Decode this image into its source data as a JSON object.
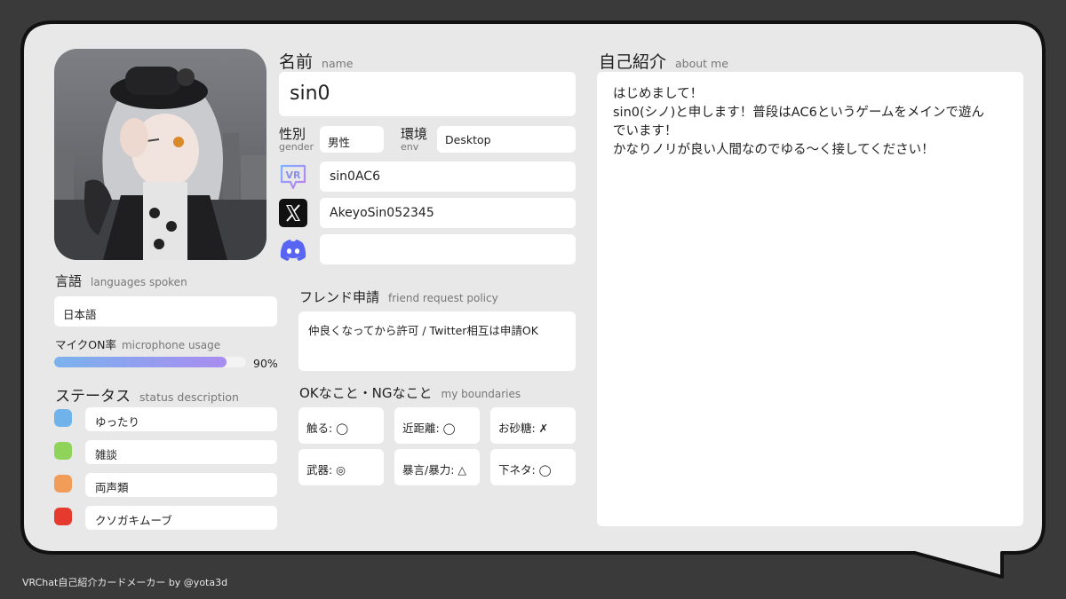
{
  "profile": {
    "avatar_alt": "avatar portrait",
    "name_title": "名前",
    "name_sub": "name",
    "name_value": "sin0",
    "gender_title": "性別",
    "gender_sub": "gender",
    "gender_value": "男性",
    "env_title": "環境",
    "env_sub": "env",
    "env_value": "Desktop",
    "vrchat_icon": "vrchat-icon",
    "vrchat_id": "sin0AC6",
    "x_icon": "x-logo-icon",
    "x_id": "AkeyoSin052345",
    "discord_icon": "discord-icon",
    "discord_id": ""
  },
  "languages": {
    "title": "言語",
    "sub": "languages spoken",
    "value": "日本語"
  },
  "mic": {
    "title": "マイクON率",
    "sub": "microphone usage",
    "percent_label": "90%",
    "level": 0.9
  },
  "status": {
    "title": "ステータス",
    "sub": "status description",
    "items": [
      {
        "label": "ゆったり",
        "color": "#6fb3ea"
      },
      {
        "label": "雑談",
        "color": "#8fd35b"
      },
      {
        "label": "両声類",
        "color": "#f19c59"
      },
      {
        "label": "クソガキムーブ",
        "color": "#e63a2e"
      }
    ]
  },
  "friend": {
    "title": "フレンド申請",
    "sub": "friend request policy",
    "value": "仲良くなってから許可 / Twitter相互は申請OK"
  },
  "boundaries": {
    "title": "OKなこと・NGなこと",
    "sub": "my boundaries",
    "items": [
      "触る: ◯",
      "近距離: ◯",
      "お砂糖: ✗",
      "武器: ◎",
      "暴言/暴力: △",
      "下ネタ: ◯"
    ]
  },
  "about": {
    "title": "自己紹介",
    "sub": "about me",
    "lines": [
      "はじめまして！",
      "sin0(シノ)と申します！普段はAC6というゲームをメインで遊ん",
      "でいます！",
      "かなりノリが良い人間なのでゆる〜く接してください！"
    ]
  },
  "footer": {
    "credit": "VRChat自己紹介カードメーカー by @yota3d"
  },
  "colors": {
    "background": "#3a3a3a",
    "card": "#e8e8e8",
    "mic_bar_start": "#7ab2ee",
    "mic_bar_end": "#a98cf0"
  }
}
